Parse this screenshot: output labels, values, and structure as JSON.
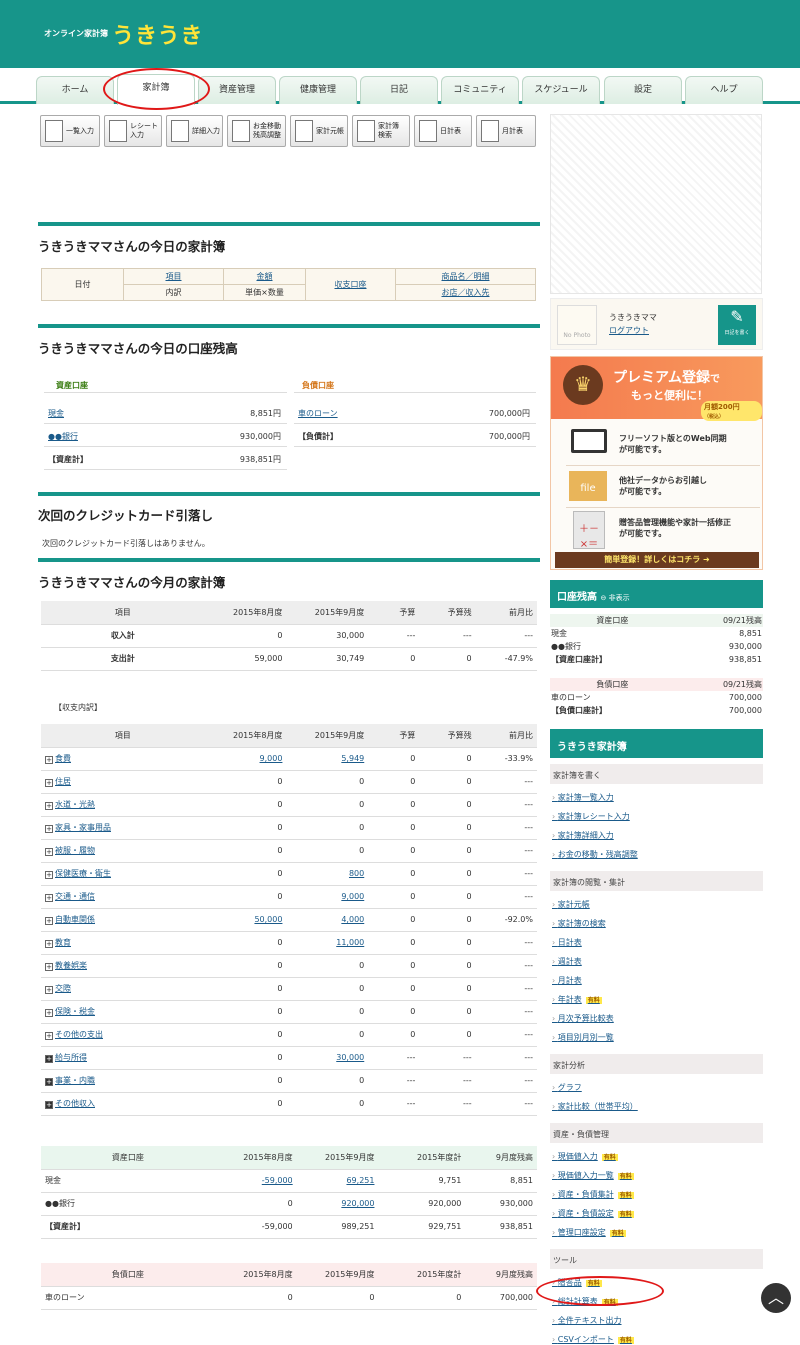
{
  "header": {
    "small": "オンライン家計簿",
    "logo": "うきうき"
  },
  "tabs": [
    "ホーム",
    "家計簿",
    "資産管理",
    "健康管理",
    "日記",
    "コミュニティ",
    "スケジュール",
    "設定",
    "ヘルプ"
  ],
  "toolbar": [
    "一覧入力",
    "レシート入力",
    "詳細入力",
    "お金移動\n残高調整",
    "家計元帳",
    "家計簿\n検索",
    "日計表",
    "月計表"
  ],
  "today": {
    "title": "うきうきママさんの今日の家計簿",
    "headers": {
      "date": "日付",
      "item": "項目",
      "detail": "内訳",
      "amount": "金額",
      "unit": "単価×数量",
      "account": "収支口座",
      "product": "商品名／明細",
      "shop": "お店／収入先"
    }
  },
  "balance": {
    "title": "うきうきママさんの今日の口座残高",
    "asset_head": "資産口座",
    "debt_head": "負債口座",
    "assets": [
      [
        "現金",
        "8,851円"
      ],
      [
        "●●銀行",
        "930,000円"
      ],
      [
        "【資産計】",
        "938,851円"
      ]
    ],
    "debts": [
      [
        "車のローン",
        "700,000円"
      ],
      [
        "【負債計】",
        "700,000円"
      ]
    ]
  },
  "credit": {
    "title": "次回のクレジットカード引落し",
    "text": "次回のクレジットカード引落しはありません。"
  },
  "month": {
    "title": "うきうきママさんの今月の家計簿",
    "cols": [
      "項目",
      "2015年8月度",
      "2015年9月度",
      "予算",
      "予算残",
      "前月比"
    ],
    "rows": [
      [
        "収入計",
        "0",
        "30,000",
        "---",
        "---",
        "---"
      ],
      [
        "支出計",
        "59,000",
        "30,749",
        "0",
        "0",
        "-47.9%"
      ]
    ]
  },
  "breakdown": {
    "label": "【収支内訳】",
    "cols": [
      "項目",
      "2015年8月度",
      "2015年9月度",
      "予算",
      "予算残",
      "前月比"
    ],
    "rows": [
      [
        "食費",
        "9,000",
        "5,949",
        "0",
        "0",
        "-33.9%"
      ],
      [
        "住居",
        "0",
        "0",
        "0",
        "0",
        "---"
      ],
      [
        "水道・光熱",
        "0",
        "0",
        "0",
        "0",
        "---"
      ],
      [
        "家具・家事用品",
        "0",
        "0",
        "0",
        "0",
        "---"
      ],
      [
        "被服・履物",
        "0",
        "0",
        "0",
        "0",
        "---"
      ],
      [
        "保健医療・衛生",
        "0",
        "800",
        "0",
        "0",
        "---"
      ],
      [
        "交通・通信",
        "0",
        "9,000",
        "0",
        "0",
        "---"
      ],
      [
        "自動車関係",
        "50,000",
        "4,000",
        "0",
        "0",
        "-92.0%"
      ],
      [
        "教育",
        "0",
        "11,000",
        "0",
        "0",
        "---"
      ],
      [
        "教養娯楽",
        "0",
        "0",
        "0",
        "0",
        "---"
      ],
      [
        "交際",
        "0",
        "0",
        "0",
        "0",
        "---"
      ],
      [
        "保険・税金",
        "0",
        "0",
        "0",
        "0",
        "---"
      ],
      [
        "その他の支出",
        "0",
        "0",
        "0",
        "0",
        "---"
      ],
      [
        "給与所得",
        "0",
        "30,000",
        "---",
        "---",
        "---"
      ],
      [
        "事業・内職",
        "0",
        "0",
        "---",
        "---",
        "---"
      ],
      [
        "その他収入",
        "0",
        "0",
        "---",
        "---",
        "---"
      ]
    ]
  },
  "assetsTable": {
    "cols": [
      "資産口座",
      "2015年8月度",
      "2015年9月度",
      "2015年度計",
      "9月度残高"
    ],
    "rows": [
      [
        "現金",
        "-59,000",
        "69,251",
        "9,751",
        "8,851"
      ],
      [
        "●●銀行",
        "0",
        "920,000",
        "920,000",
        "930,000"
      ],
      [
        "【資産計】",
        "-59,000",
        "989,251",
        "929,751",
        "938,851"
      ]
    ]
  },
  "debtsTable": {
    "cols": [
      "負債口座",
      "2015年8月度",
      "2015年9月度",
      "2015年度計",
      "9月度残高"
    ],
    "rows": [
      [
        "車のローン",
        "0",
        "0",
        "0",
        "700,000"
      ]
    ]
  },
  "profile": {
    "name": "うきうきママ",
    "logout": "ログアウト",
    "photo": "No Photo",
    "diary": "日記を書く"
  },
  "premium": {
    "title1": "プレミアム登録",
    "title2": "で",
    "title3": "もっと便利に！",
    "price": "月額200円",
    "tax": "（税込）",
    "f1a": "フリーソフト版とのWeb同期",
    "f1b": "が可能です。",
    "f2a": "他社データからお引越し",
    "f2b": "が可能です。",
    "f3a": "贈答品管理機能や家計一括修正",
    "f3b": "が可能です。",
    "file": "file",
    "cta": "簡単登録！詳しくはコチラ"
  },
  "sbBalance": {
    "title": "口座残高",
    "hide": "非表示",
    "assetHead": "資産口座",
    "date": "09/21残高",
    "assets": [
      [
        "現金",
        "8,851"
      ],
      [
        "●●銀行",
        "930,000"
      ],
      [
        "【資産口座計】",
        "938,851"
      ]
    ],
    "debtHead": "負債口座",
    "debts": [
      [
        "車のローン",
        "700,000"
      ],
      [
        "【負債口座計】",
        "700,000"
      ]
    ]
  },
  "menu": {
    "title": "うきうき家計簿",
    "paid": "有料",
    "cats": [
      {
        "name": "家計簿を書く",
        "items": [
          [
            "家計簿一覧入力",
            false
          ],
          [
            "家計簿レシート入力",
            false
          ],
          [
            "家計簿詳細入力",
            false
          ],
          [
            "お金の移動・残高調整",
            false
          ]
        ]
      },
      {
        "name": "家計簿の閲覧・集計",
        "items": [
          [
            "家計元帳",
            false
          ],
          [
            "家計簿の検索",
            false
          ],
          [
            "日計表",
            false
          ],
          [
            "週計表",
            false
          ],
          [
            "月計表",
            false
          ],
          [
            "年計表",
            true
          ],
          [
            "月次予算比較表",
            false
          ],
          [
            "項目別月別一覧",
            false
          ]
        ]
      },
      {
        "name": "家計分析",
        "items": [
          [
            "グラフ",
            false
          ],
          [
            "家計比較（世帯平均）",
            false
          ]
        ]
      },
      {
        "name": "資産・負債管理",
        "items": [
          [
            "現価値入力",
            true
          ],
          [
            "現価値入力一覧",
            true
          ],
          [
            "資産・負債集計",
            true
          ],
          [
            "資産・負債設定",
            true
          ],
          [
            "管理口座設定",
            true
          ]
        ]
      },
      {
        "name": "ツール",
        "items": [
          [
            "贈答品",
            true
          ],
          [
            "総計計算表",
            true
          ],
          [
            "全件テキスト出力",
            false
          ],
          [
            "CSVインポート",
            true
          ]
        ]
      }
    ]
  }
}
